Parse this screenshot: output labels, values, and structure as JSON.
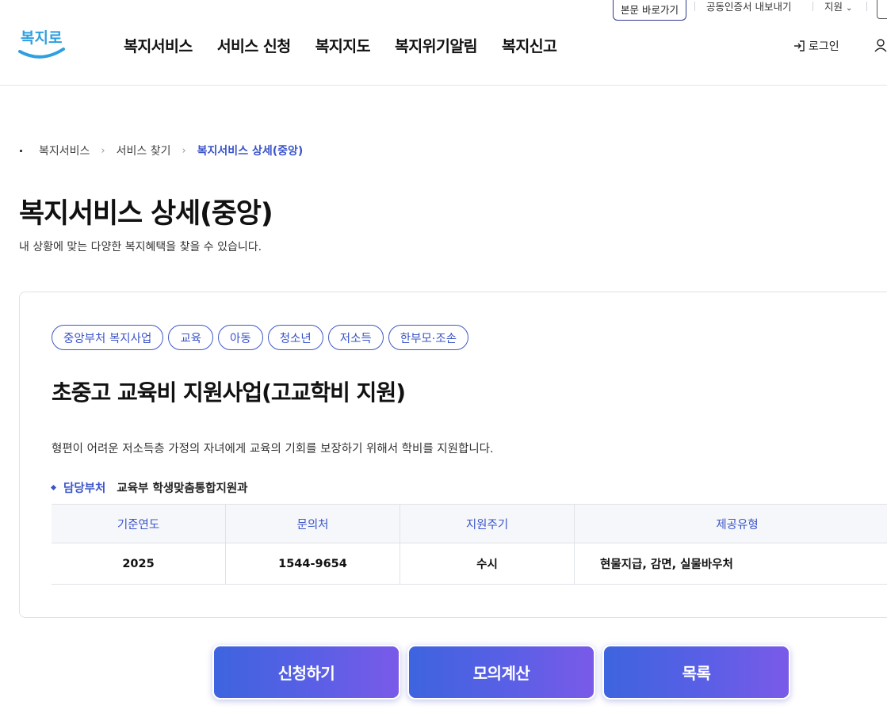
{
  "utility": {
    "skip_link": "본문 바로가기",
    "cert_export": "공동인증서 내보내기",
    "region": "지원"
  },
  "header": {
    "logo_text": "복지로",
    "nav": [
      "복지서비스",
      "서비스 신청",
      "복지지도",
      "복지위기알림",
      "복지신고"
    ],
    "login": "로그인"
  },
  "breadcrumb": [
    "복지서비스",
    "서비스 찾기",
    "복지서비스 상세(중앙)"
  ],
  "page": {
    "title": "복지서비스 상세(중앙)",
    "description": "내 상황에 맞는 다양한 복지혜택을 찾을 수 있습니다."
  },
  "service": {
    "tags": [
      "중앙부처 복지사업",
      "교육",
      "아동",
      "청소년",
      "저소득",
      "한부모·조손"
    ],
    "title": "초중고 교육비 지원사업(고교학비 지원)",
    "description": "형편이 어려운 저소득층 가정의 자녀에게 교육의 기회를 보장하기 위해서 학비를 지원합니다.",
    "dept_label": "담당부처",
    "dept_value": "교육부 학생맞춤통합지원과",
    "table": {
      "headers": [
        "기준연도",
        "문의처",
        "지원주기",
        "제공유형"
      ],
      "row": [
        "2025",
        "1544-9654",
        "수시",
        "현물지급, 감면, 실물바우처"
      ]
    }
  },
  "actions": {
    "apply": "신청하기",
    "simulate": "모의계산",
    "list": "목록"
  },
  "colors": {
    "accent": "#3b55c9",
    "button_start": "#3e64df",
    "button_end": "#7a5ae8",
    "logo_blue": "#2f9fe0"
  }
}
